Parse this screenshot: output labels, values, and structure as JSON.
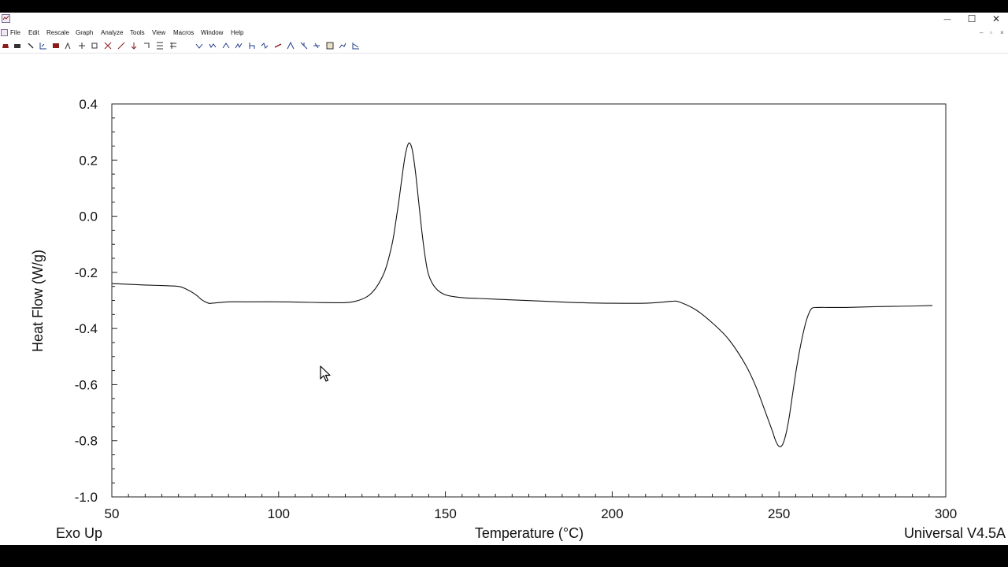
{
  "window": {
    "minimize_glyph": "—",
    "maximize_glyph": "☐",
    "close_glyph": "✕",
    "doc_minimize_glyph": "–",
    "doc_restore_glyph": "▫",
    "doc_close_glyph": "×"
  },
  "menu": {
    "items": [
      "File",
      "Edit",
      "Rescale",
      "Graph",
      "Analyze",
      "Tools",
      "View",
      "Macros",
      "Window",
      "Help"
    ]
  },
  "toolbar": {
    "icons": [
      "open-icon",
      "print-icon",
      "cursor-tool-icon",
      "axes-icon",
      "analysis-icon",
      "peak-icon",
      "rescale-icon",
      "full-scale-icon",
      "zoom-icon",
      "x-scale-icon",
      "y-scale-icon",
      "limits-icon",
      "cursor-mode-icon",
      "signal-change-icon",
      "onset-icon",
      "peak-max-icon",
      "integrate-icon",
      "step-transition-icon",
      "glass-transition-icon",
      "inflection-icon",
      "baseline-icon",
      "slope-icon",
      "marker-icon",
      "curve-values-icon",
      "table-icon",
      "report-icon",
      "export-icon"
    ],
    "colors": {
      "accent": "#8a1c1c",
      "secondary": "#1f3d8a",
      "neutral": "#333333"
    }
  },
  "chart_data": {
    "type": "line",
    "title": "",
    "xlabel": "Temperature (°C)",
    "ylabel": "Heat Flow (W/g)",
    "xlim": [
      50,
      300
    ],
    "ylim": [
      -1.0,
      0.4
    ],
    "x_ticks": [
      "50",
      "100",
      "150",
      "200",
      "250",
      "300"
    ],
    "y_ticks": [
      "0.4",
      "0.2",
      "0.0",
      "-0.2",
      "-0.4",
      "-0.6",
      "-0.8",
      "-1.0"
    ],
    "bottom_left_label": "Exo Up",
    "bottom_right_label": "Universal V4.5A",
    "grid": false,
    "line_color": "#111111",
    "series": [
      {
        "x": [
          50,
          60,
          65,
          70,
          72,
          75,
          77,
          79,
          80,
          85,
          90,
          100,
          110,
          115,
          120,
          123,
          126,
          128,
          130,
          132,
          134,
          135,
          136,
          137,
          138,
          139,
          140,
          141,
          142,
          143,
          144,
          145,
          147,
          150,
          155,
          160,
          170,
          180,
          190,
          200,
          210,
          215,
          218,
          220,
          225,
          230,
          235,
          240,
          243,
          246,
          248,
          249,
          250,
          251,
          252,
          253,
          254,
          255,
          256,
          257,
          258,
          259,
          260,
          262,
          265,
          270,
          280,
          290,
          296
        ],
        "y": [
          -0.24,
          -0.245,
          -0.247,
          -0.25,
          -0.258,
          -0.278,
          -0.298,
          -0.31,
          -0.31,
          -0.305,
          -0.305,
          -0.305,
          -0.307,
          -0.308,
          -0.308,
          -0.303,
          -0.29,
          -0.272,
          -0.24,
          -0.19,
          -0.1,
          -0.03,
          0.05,
          0.14,
          0.22,
          0.26,
          0.24,
          0.16,
          0.05,
          -0.06,
          -0.15,
          -0.21,
          -0.255,
          -0.28,
          -0.29,
          -0.293,
          -0.298,
          -0.303,
          -0.308,
          -0.31,
          -0.31,
          -0.306,
          -0.303,
          -0.305,
          -0.333,
          -0.38,
          -0.44,
          -0.53,
          -0.605,
          -0.7,
          -0.765,
          -0.8,
          -0.82,
          -0.815,
          -0.78,
          -0.72,
          -0.64,
          -0.56,
          -0.49,
          -0.43,
          -0.38,
          -0.345,
          -0.327,
          -0.325,
          -0.325,
          -0.325,
          -0.322,
          -0.32,
          -0.318
        ]
      }
    ]
  }
}
